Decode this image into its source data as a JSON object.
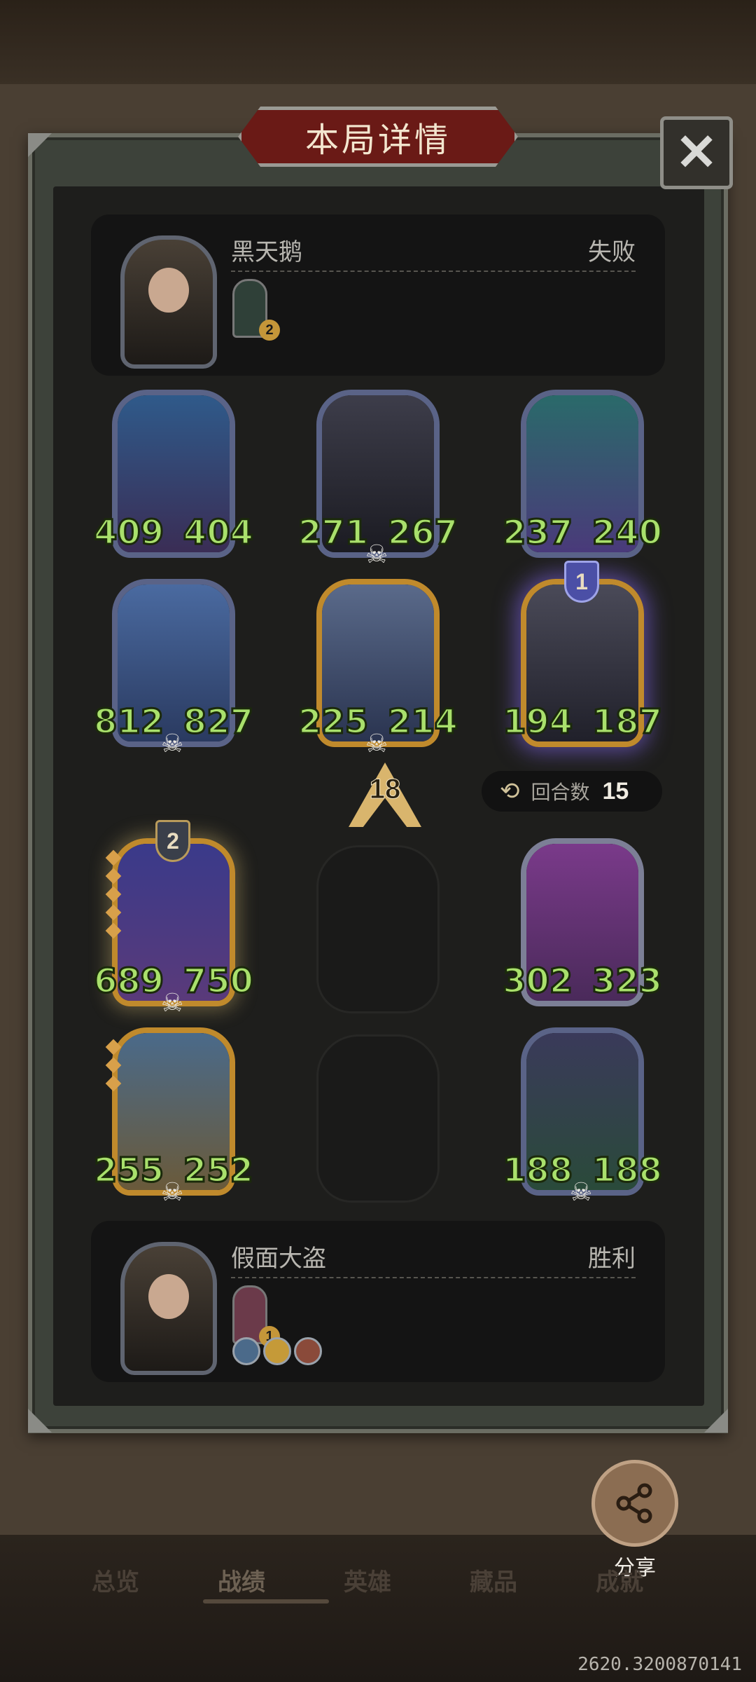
{
  "title": "本局详情",
  "close_label": "✕",
  "opponent": {
    "name": "黑天鹅",
    "result": "失败",
    "item_level": "2"
  },
  "player": {
    "name": "假面大盗",
    "result": "胜利",
    "item_level": "1"
  },
  "board_rows": [
    [
      {
        "atk": "409",
        "hp": "404"
      },
      {
        "atk": "271",
        "hp": "267"
      },
      {
        "atk": "237",
        "hp": "240"
      }
    ],
    [
      {
        "atk": "812",
        "hp": "827"
      },
      {
        "atk": "225",
        "hp": "214"
      },
      {
        "atk": "194",
        "hp": "187",
        "badge": "1"
      }
    ],
    [
      {
        "atk": "689",
        "hp": "750",
        "badge": "2"
      },
      null,
      {
        "atk": "302",
        "hp": "323"
      }
    ],
    [
      {
        "atk": "255",
        "hp": "252"
      },
      null,
      {
        "atk": "188",
        "hp": "188"
      }
    ]
  ],
  "tier": "18",
  "rounds": {
    "label": "回合数",
    "value": "15"
  },
  "share_label": "分享",
  "tabs": [
    "总览",
    "战绩",
    "英雄",
    "藏品",
    "成就"
  ],
  "active_tab": "战绩",
  "version": "2620.3200870141",
  "colors": {
    "stat_green": "#a9e06c",
    "banner_red": "#6a1a16",
    "gold_frame": "#c08a2c"
  }
}
